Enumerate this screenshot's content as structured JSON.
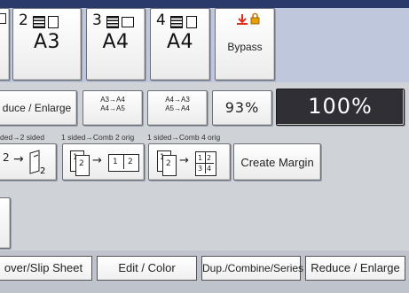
{
  "paper_trays": [
    {
      "number": "2",
      "size": "A3"
    },
    {
      "number": "3",
      "size": "A4"
    },
    {
      "number": "4",
      "size": "A4"
    }
  ],
  "bypass": {
    "label": "Bypass"
  },
  "reduce_enlarge_row": {
    "reduce_enlarge_label": "duce / Enlarge",
    "ratio1_line1": "A3→A4",
    "ratio1_line2": "A4→A5",
    "ratio2_line1": "A4→A3",
    "ratio2_line2": "A5→A4",
    "percent_93": "93%",
    "percent_100": "100%"
  },
  "duplex_row": {
    "caption_left": "ded→2 sided",
    "caption_mid": "1 sided→Comb 2 orig",
    "caption_right": "1 sided→Comb 4 orig",
    "create_margin": "Create Margin"
  },
  "bottom_tabs": [
    {
      "label": "over/Slip Sheet"
    },
    {
      "label": "Edit / Color"
    },
    {
      "label": "Dup./Combine/Series"
    },
    {
      "label": "Reduce / Enlarge"
    }
  ],
  "colors": {
    "accent": "#e0301e",
    "bar": "#2a3a6a",
    "dark_button": "#2f2f35"
  }
}
